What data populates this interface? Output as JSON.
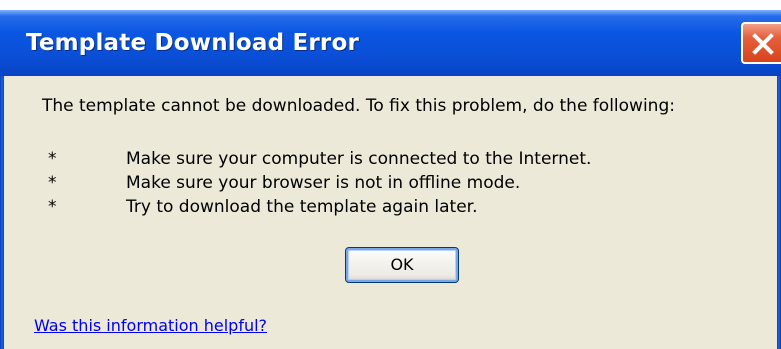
{
  "window": {
    "title": "Template Download Error",
    "close_icon": "close-icon",
    "close_color": "#d8431c",
    "titlebar_color": "#0a56e2"
  },
  "message": {
    "intro": "The template cannot be downloaded. To fix this problem, do the following:",
    "bullets": [
      {
        "marker": "*",
        "text": "Make sure your computer is connected to the Internet."
      },
      {
        "marker": "*",
        "text": "Make sure your browser is not in offline mode."
      },
      {
        "marker": "*",
        "text": "Try to download the template again later."
      }
    ]
  },
  "buttons": {
    "ok_label": "OK"
  },
  "footer": {
    "help_link": "Was this information helpful?"
  }
}
